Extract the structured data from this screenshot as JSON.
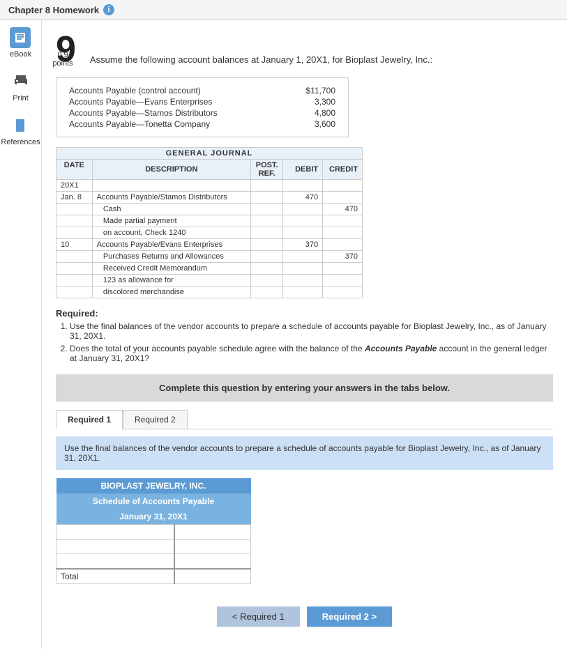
{
  "topBar": {
    "title": "Chapter 8 Homework"
  },
  "sidebar": {
    "items": [
      {
        "id": "ebook",
        "label": "eBook",
        "icon": "book"
      },
      {
        "id": "print",
        "label": "Print",
        "icon": "printer"
      },
      {
        "id": "references",
        "label": "References",
        "icon": "bookmark"
      }
    ]
  },
  "question": {
    "number": "9",
    "points": "0.9",
    "pointsLabel": "points",
    "intro": "Assume the following account balances at January 1, 20X1, for Bioplast Jewelry, Inc.:",
    "accounts": [
      {
        "name": "Accounts Payable (control account)",
        "amount": "$11,700"
      },
      {
        "name": "Accounts Payable—Evans Enterprises",
        "amount": "3,300"
      },
      {
        "name": "Accounts Payable—Stamos Distributors",
        "amount": "4,800"
      },
      {
        "name": "Accounts Payable—Tonetta Company",
        "amount": "3,600"
      }
    ],
    "journal": {
      "title": "GENERAL JOURNAL",
      "headers": [
        "DATE",
        "DESCRIPTION",
        "POST. REF.",
        "DEBIT",
        "CREDIT"
      ],
      "entries": [
        {
          "date": "20X1",
          "lines": []
        },
        {
          "date": "Jan. 8",
          "desc": "Accounts Payable/Stamos Distributors",
          "ref": "",
          "debit": "470",
          "credit": ""
        },
        {
          "date": "",
          "desc": "    Cash",
          "ref": "",
          "debit": "",
          "credit": "470"
        },
        {
          "date": "",
          "desc": "    Made partial payment",
          "ref": "",
          "debit": "",
          "credit": ""
        },
        {
          "date": "",
          "desc": "    on account, Check 1240",
          "ref": "",
          "debit": "",
          "credit": ""
        },
        {
          "date": "10",
          "desc": "Accounts Payable/Evans Enterprises",
          "ref": "",
          "debit": "370",
          "credit": ""
        },
        {
          "date": "",
          "desc": "    Purchases Returns and Allowances",
          "ref": "",
          "debit": "",
          "credit": "370"
        },
        {
          "date": "",
          "desc": "    Received Credit Memorandum",
          "ref": "",
          "debit": "",
          "credit": ""
        },
        {
          "date": "",
          "desc": "    123 as allowance for",
          "ref": "",
          "debit": "",
          "credit": ""
        },
        {
          "date": "",
          "desc": "    discolored merchandise",
          "ref": "",
          "debit": "",
          "credit": ""
        }
      ]
    },
    "required": {
      "label": "Required:",
      "items": [
        "Use the final balances of the vendor accounts to prepare a schedule of accounts payable for Bioplast Jewelry, Inc., as of January 31, 20X1.",
        "Does the total of your accounts payable schedule agree with the balance of the <b>Accounts Payable</b> account in the general ledger at January 31, 20X1?"
      ]
    }
  },
  "completeBox": {
    "text": "Complete this question by entering your answers in the tabs below."
  },
  "tabs": [
    {
      "id": "required1",
      "label": "Required 1",
      "active": true
    },
    {
      "id": "required2",
      "label": "Required 2",
      "active": false
    }
  ],
  "tabInstruction": "Use the final balances of the vendor accounts to prepare a schedule of accounts payable for Bioplast Jewelry, Inc., as of January 31, 20X1.",
  "schedule": {
    "title": "BIOPLAST JEWELRY, INC.",
    "subtitle": "Schedule of Accounts Payable",
    "date": "January 31, 20X1",
    "rows": [
      {
        "name": "",
        "amount": ""
      },
      {
        "name": "",
        "amount": ""
      },
      {
        "name": "",
        "amount": ""
      }
    ],
    "totalLabel": "Total",
    "totalAmount": ""
  },
  "bottomNav": {
    "prevLabel": "< Required 1",
    "nextLabel": "Required 2 >"
  }
}
